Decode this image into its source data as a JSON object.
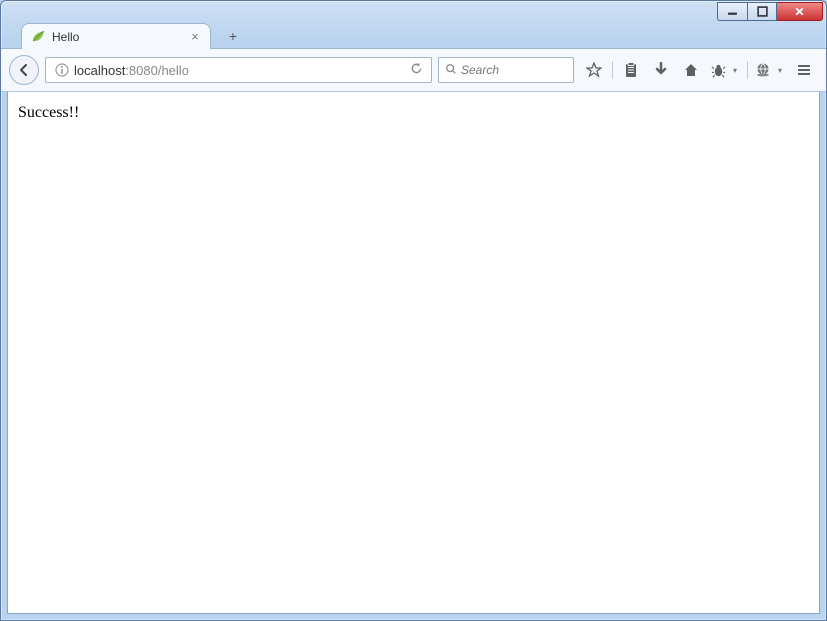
{
  "window": {
    "title": "Hello"
  },
  "tab": {
    "title": "Hello",
    "favicon_name": "leaf-icon"
  },
  "address": {
    "host": "localhost",
    "rest": ":8080/hello",
    "full": "localhost:8080/hello"
  },
  "search": {
    "placeholder": "Search"
  },
  "page": {
    "body_text": "Success!!"
  },
  "icons": {
    "back": "back-icon",
    "info": "info-icon",
    "reload": "reload-icon",
    "search": "search-icon",
    "bookmark_star": "star-icon",
    "clipboard": "clipboard-icon",
    "downloads": "download-arrow-icon",
    "home": "home-icon",
    "bug": "bug-icon",
    "globe": "globe-icon",
    "menu": "hamburger-icon",
    "close_tab": "close-icon",
    "new_tab": "plus-icon",
    "minimize": "minimize-icon",
    "maximize": "maximize-icon",
    "close_win": "close-window-icon"
  }
}
